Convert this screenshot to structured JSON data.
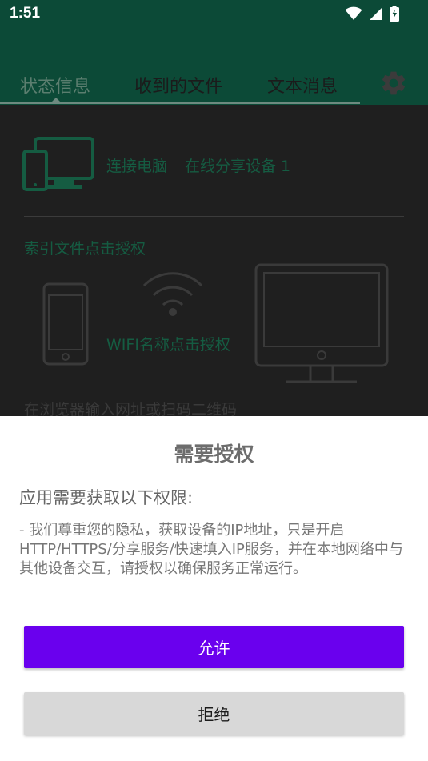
{
  "status_bar": {
    "time": "1:51",
    "icons": [
      "wifi-icon",
      "signal-icon",
      "battery-charging-icon"
    ]
  },
  "tabs": [
    {
      "label": "状态信息",
      "active": true
    },
    {
      "label": "收到的文件",
      "active": false
    },
    {
      "label": "文本消息",
      "active": false
    }
  ],
  "settings_icon": "gear-icon",
  "content": {
    "connect_pc": "连接电脑",
    "online_devices": "在线分享设备 1",
    "index_files": "索引文件点击授权",
    "wifi_name": "WIFI名称点击授权",
    "browser_hint": "在浏览器输入网址或扫码二维码"
  },
  "dialog": {
    "title": "需要授权",
    "subtitle": "应用需要获取以下权限:",
    "description": "- 我们尊重您的隐私，获取设备的IP地址，只是开启HTTP/HTTPS/分享服务/快速填入IP服务，并在本地网络中与其他设备交互，请授权以确保服务正常运行。",
    "allow_label": "允许",
    "deny_label": "拒绝"
  },
  "colors": {
    "app_bar": "#0c4a37",
    "accent_green": "#155c42",
    "allow_button": "#6a00ee",
    "deny_button": "#d8d8d8"
  }
}
